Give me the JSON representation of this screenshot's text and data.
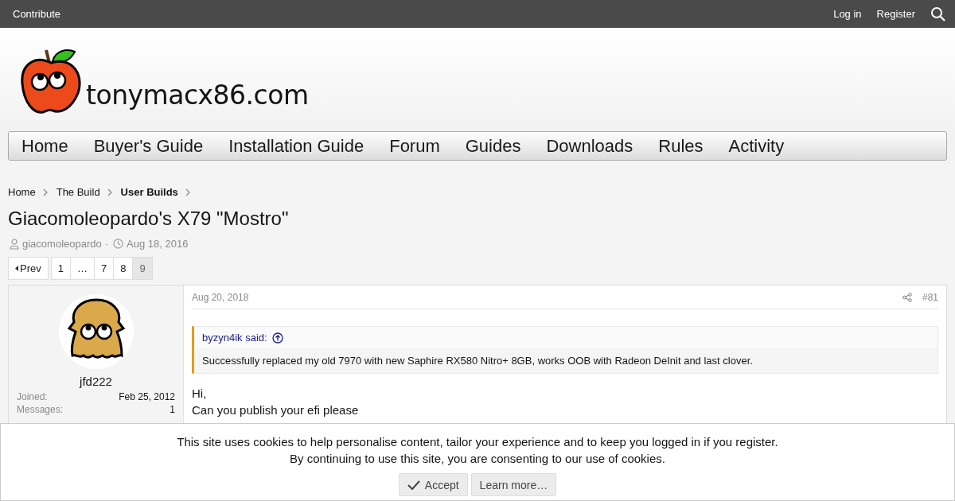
{
  "top_bar": {
    "left_link": "Contribute",
    "right_links": [
      "Log in",
      "Register"
    ]
  },
  "logo": {
    "text": "tonymacx86.com"
  },
  "nav": [
    {
      "label": "Home"
    },
    {
      "label": "Buyer's Guide"
    },
    {
      "label": "Installation Guide"
    },
    {
      "label": "Forum"
    },
    {
      "label": "Guides"
    },
    {
      "label": "Downloads"
    },
    {
      "label": "Rules"
    },
    {
      "label": "Activity"
    }
  ],
  "breadcrumbs": [
    {
      "label": "Home",
      "current": false
    },
    {
      "label": "The Build",
      "current": false
    },
    {
      "label": "User Builds",
      "current": true
    }
  ],
  "thread": {
    "title": "Giacomoleopardo's X79 \"Mostro\"",
    "author": "giacomoleopardo",
    "separator": "·",
    "date": "Aug 18, 2016"
  },
  "pagination": {
    "prev": "Prev",
    "pages": [
      {
        "label": "1",
        "selected": false
      },
      {
        "label": "…",
        "selected": false
      },
      {
        "label": "7",
        "selected": false
      },
      {
        "label": "8",
        "selected": false
      },
      {
        "label": "9",
        "selected": true
      }
    ]
  },
  "post": {
    "username": "jfd222",
    "stats": [
      {
        "label": "Joined:",
        "value": "Feb 25, 2012"
      },
      {
        "label": "Messages:",
        "value": "1"
      }
    ],
    "date": "Aug 20, 2018",
    "number": "#81",
    "quote": {
      "author": "byzyn4ik said:",
      "text": "Successfully replaced my old 7970 with new Saphire RX580 Nitro+ 8GB, works OOB with Radeon DeInit and last clover."
    },
    "body": [
      "Hi,",
      "Can you publish your efi please"
    ]
  },
  "cookie_notice": {
    "lines": [
      "This site uses cookies to help personalise content, tailor your experience and to keep you logged in if you register.",
      "By continuing to use this site, you are consenting to our use of cookies."
    ],
    "accept": "Accept",
    "learn_more": "Learn more…"
  }
}
